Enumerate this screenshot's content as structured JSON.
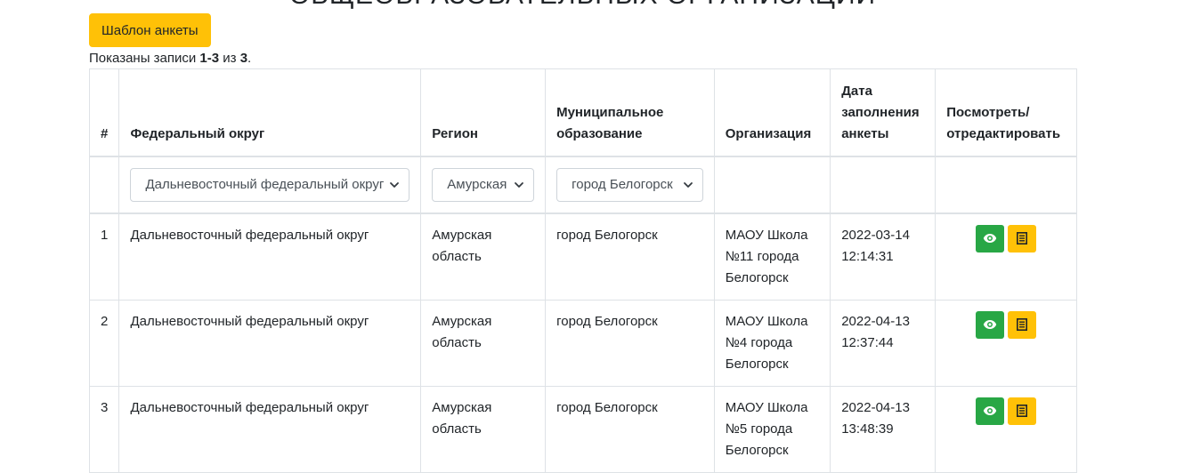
{
  "page": {
    "title": "ОБЩЕОБРАЗОВАТЕЛЬНЫХ ОРГАНИЗАЦИЙ"
  },
  "toolbar": {
    "template_button": "Шаблон анкеты"
  },
  "summary": {
    "prefix": "Показаны записи ",
    "range": "1-3",
    "middle": " из ",
    "total": "3",
    "suffix": "."
  },
  "table": {
    "headers": {
      "num": "#",
      "district": "Федеральный округ",
      "region": "Регион",
      "municipality": "Муниципальное образование",
      "organization": "Организация",
      "date": "Дата заполнения анкеты",
      "actions": "Посмотреть/ отредактировать"
    },
    "filters": {
      "district": "Дальневосточный федеральный округ",
      "region": "Амурская",
      "municipality": "город Белогорск"
    },
    "rows": [
      {
        "num": "1",
        "district": "Дальневосточный федеральный округ",
        "region": "Амурская область",
        "municipality": "город Белогорск",
        "organization": "МАОУ Школа №11 города Белогорск",
        "date": "2022-03-14 12:14:31"
      },
      {
        "num": "2",
        "district": "Дальневосточный федеральный округ",
        "region": "Амурская область",
        "municipality": "город Белогорск",
        "organization": "МАОУ Школа №4 города Белогорск",
        "date": "2022-04-13 12:37:44"
      },
      {
        "num": "3",
        "district": "Дальневосточный федеральный округ",
        "region": "Амурская область",
        "municipality": "город Белогорск",
        "organization": "МАОУ Школа №5 города Белогорск",
        "date": "2022-04-13 13:48:39"
      }
    ]
  },
  "icons": {
    "view": "eye-icon",
    "edit": "list-icon",
    "dropdown": "chevron-down-icon"
  },
  "colors": {
    "warning": "#ffc107",
    "success": "#28a745",
    "border": "#dee2e6"
  }
}
